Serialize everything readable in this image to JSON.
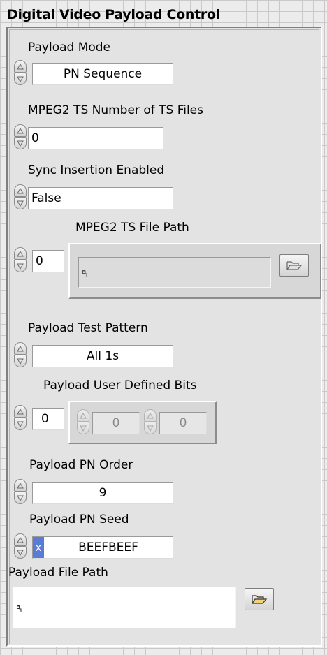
{
  "cluster": {
    "title": "Digital Video Payload Control"
  },
  "payload_mode": {
    "label": "Payload Mode",
    "value": "PN Sequence"
  },
  "mpeg2_num_files": {
    "label": "MPEG2 TS Number of TS Files",
    "value": "0"
  },
  "sync_insertion": {
    "label": "Sync Insertion Enabled",
    "value": "False"
  },
  "mpeg2_file_path": {
    "label": "MPEG2 TS File Path",
    "index_value": "0",
    "path_value": ""
  },
  "test_pattern": {
    "label": "Payload Test Pattern",
    "value": "All 1s"
  },
  "user_bits": {
    "label": "Payload User Defined Bits",
    "index_value": "0",
    "elements": [
      "0",
      "0"
    ]
  },
  "pn_order": {
    "label": "Payload PN Order",
    "value": "9"
  },
  "pn_seed": {
    "label": "Payload PN Seed",
    "radix": "x",
    "value": "BEEFBEEF"
  },
  "payload_file_path": {
    "label": "Payload File Path",
    "value": ""
  },
  "icons": {
    "spinner": "increment-decrement-icon",
    "browse": "folder-open-icon",
    "path": "path-symbol-icon"
  },
  "colors": {
    "radix_highlight": "#5a7bd6",
    "panel": "#e3e3e3",
    "grid": "#c9c9c9"
  }
}
